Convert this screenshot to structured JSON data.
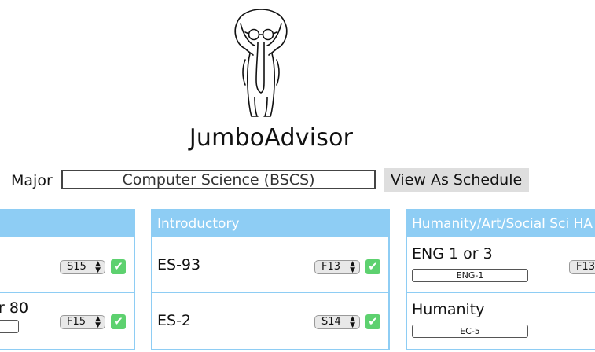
{
  "app": {
    "title": "JumboAdvisor"
  },
  "major": {
    "label": "Major",
    "value": "Computer Science (BSCS)",
    "view_button": "View As Schedule"
  },
  "columns": [
    {
      "header": "",
      "rows": [
        {
          "course": "",
          "term": "S15"
        },
        {
          "course": "r 80",
          "term": "F15"
        }
      ]
    },
    {
      "header": "Introductory",
      "rows": [
        {
          "course": "ES-93",
          "term": "F13"
        },
        {
          "course": "ES-2",
          "term": "S14"
        }
      ]
    },
    {
      "header": "Humanity/Art/Social Sci HA",
      "rows": [
        {
          "course": "ENG 1 or 3",
          "code": "ENG-1",
          "term": "F13"
        },
        {
          "course": "Humanity",
          "code": "EC-5"
        }
      ]
    }
  ],
  "colors": {
    "accent": "#8ecdf4",
    "check": "#5dd16f"
  }
}
